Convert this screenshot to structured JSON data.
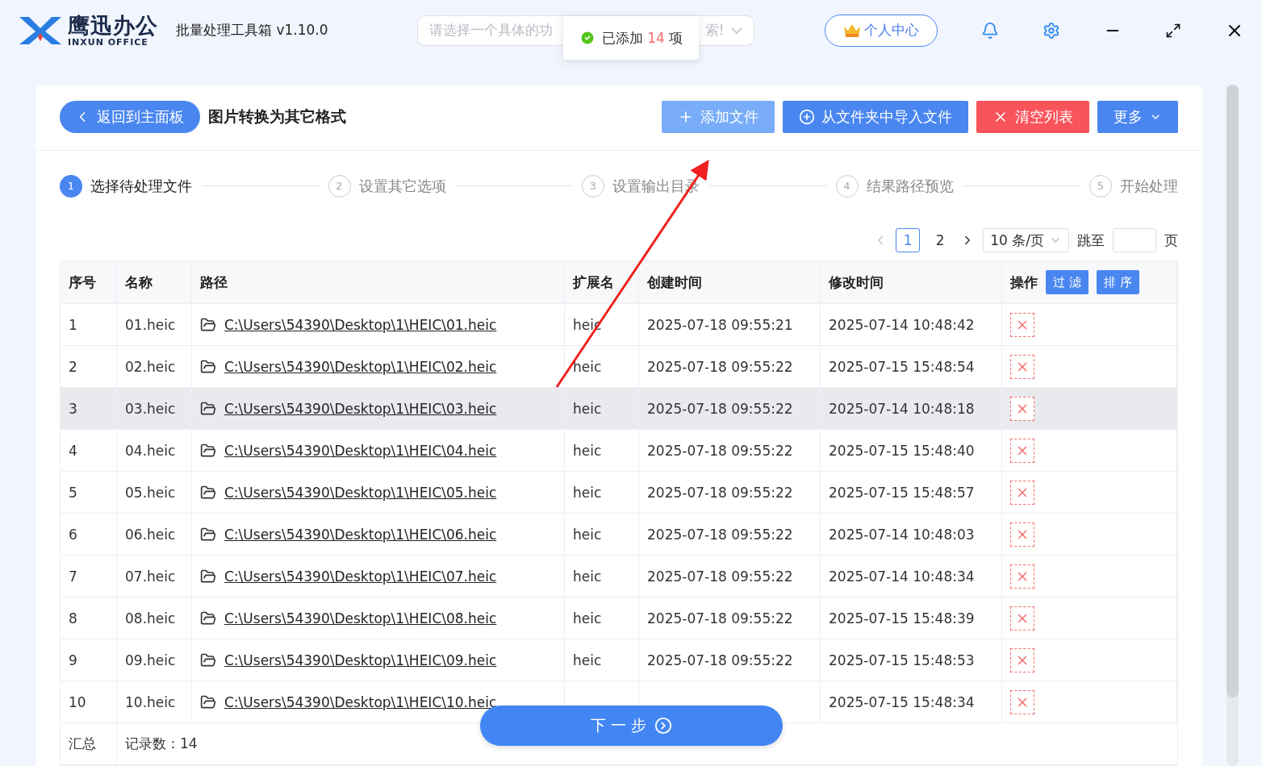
{
  "app": {
    "logo_name": "鹰迅办公",
    "logo_sub": "INXUN OFFICE",
    "title": "批量处理工具箱 v1.10.0"
  },
  "search": {
    "placeholder_start": "请选择一个具体的功",
    "placeholder_end": "索!"
  },
  "toast": {
    "prefix": "已添加",
    "count": "14",
    "suffix": "项"
  },
  "user_button": "个人中心",
  "page": {
    "back": "返回到主面板",
    "title": "图片转换为其它格式"
  },
  "actions": [
    {
      "kind": "add",
      "label": "添加文件"
    },
    {
      "kind": "folder",
      "label": "从文件夹中导入文件"
    },
    {
      "kind": "clear",
      "label": "清空列表"
    },
    {
      "kind": "more",
      "label": "更多"
    }
  ],
  "steps": [
    {
      "number": "1",
      "label": "选择待处理文件",
      "selected": true
    },
    {
      "number": "2",
      "label": "设置其它选项",
      "selected": false
    },
    {
      "number": "3",
      "label": "设置输出目录",
      "selected": false
    },
    {
      "number": "4",
      "label": "结果路径预览",
      "selected": false
    },
    {
      "number": "5",
      "label": "开始处理",
      "selected": false
    }
  ],
  "pagination": {
    "pages": [
      {
        "label": "1",
        "selected": true
      },
      {
        "label": "2",
        "selected": false
      }
    ],
    "page_size": "10 条/页",
    "jump_label": "跳至",
    "page_unit": "页"
  },
  "table": {
    "columns": [
      "序号",
      "名称",
      "路径",
      "扩展名",
      "创建时间",
      "修改时间",
      "操作"
    ],
    "header_buttons": [
      "过 滤",
      "排 序"
    ],
    "rows": [
      {
        "index": "1",
        "name": "01.heic",
        "path": "C:\\Users\\54390\\Desktop\\1\\HEIC\\01.heic",
        "ext": "heic",
        "created": "2025-07-18 09:55:21",
        "modified": "2025-07-14 10:48:42",
        "highlighted": false
      },
      {
        "index": "2",
        "name": "02.heic",
        "path": "C:\\Users\\54390\\Desktop\\1\\HEIC\\02.heic",
        "ext": "heic",
        "created": "2025-07-18 09:55:22",
        "modified": "2025-07-15 15:48:54",
        "highlighted": false
      },
      {
        "index": "3",
        "name": "03.heic",
        "path": "C:\\Users\\54390\\Desktop\\1\\HEIC\\03.heic",
        "ext": "heic",
        "created": "2025-07-18 09:55:22",
        "modified": "2025-07-14 10:48:18",
        "highlighted": true
      },
      {
        "index": "4",
        "name": "04.heic",
        "path": "C:\\Users\\54390\\Desktop\\1\\HEIC\\04.heic",
        "ext": "heic",
        "created": "2025-07-18 09:55:22",
        "modified": "2025-07-15 15:48:40",
        "highlighted": false
      },
      {
        "index": "5",
        "name": "05.heic",
        "path": "C:\\Users\\54390\\Desktop\\1\\HEIC\\05.heic",
        "ext": "heic",
        "created": "2025-07-18 09:55:22",
        "modified": "2025-07-15 15:48:57",
        "highlighted": false
      },
      {
        "index": "6",
        "name": "06.heic",
        "path": "C:\\Users\\54390\\Desktop\\1\\HEIC\\06.heic",
        "ext": "heic",
        "created": "2025-07-18 09:55:22",
        "modified": "2025-07-14 10:48:03",
        "highlighted": false
      },
      {
        "index": "7",
        "name": "07.heic",
        "path": "C:\\Users\\54390\\Desktop\\1\\HEIC\\07.heic",
        "ext": "heic",
        "created": "2025-07-18 09:55:22",
        "modified": "2025-07-14 10:48:34",
        "highlighted": false
      },
      {
        "index": "8",
        "name": "08.heic",
        "path": "C:\\Users\\54390\\Desktop\\1\\HEIC\\08.heic",
        "ext": "heic",
        "created": "2025-07-18 09:55:22",
        "modified": "2025-07-15 15:48:39",
        "highlighted": false
      },
      {
        "index": "9",
        "name": "09.heic",
        "path": "C:\\Users\\54390\\Desktop\\1\\HEIC\\09.heic",
        "ext": "heic",
        "created": "2025-07-18 09:55:22",
        "modified": "2025-07-15 15:48:53",
        "highlighted": false
      },
      {
        "index": "10",
        "name": "10.heic",
        "path": "C:\\Users\\54390\\Desktop\\1\\HEIC\\10.heic",
        "modified": "2025-07-15 15:48:34",
        "highlighted": false
      }
    ],
    "summary": {
      "label": "汇总",
      "records": "记录数：14"
    }
  },
  "next_button": "下 一 步"
}
